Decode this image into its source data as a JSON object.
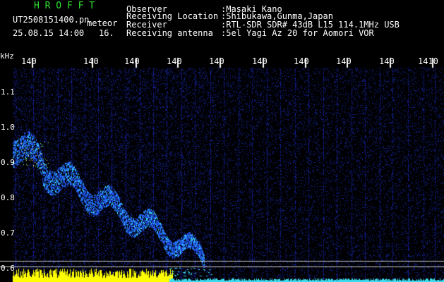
{
  "header": {
    "title": "H R O F F T",
    "filename": "UT2508151400.pn",
    "type_label": "meteor",
    "datetime": "25.08.15 14:00",
    "number": "16.",
    "observer_label": "Observer",
    "observer_value": ":Masaki Kano",
    "location_label": "Receiving Location",
    "location_value": ":Shibukawa,Gunma,Japan",
    "receiver_label": "Receiver",
    "receiver_value": ":RTL-SDR SDR# 43dB L15 114.1MHz USB",
    "antenna_label": "Receiving antenna",
    "antenna_value": ":5el Yagi Az 20 for Aomori VOR"
  },
  "axes": {
    "y_unit": "kHz",
    "y_ticks": [
      "1.1",
      "1.0",
      "0.9",
      "0.8",
      "0.7",
      "0.6"
    ],
    "x_ticks": [
      "140",
      "140",
      "140",
      "140",
      "140",
      "140",
      "140",
      "140",
      "140",
      "1410"
    ]
  },
  "colors": {
    "header_green": "#2fe32f",
    "text_white": "#ffffff",
    "background": "#000000",
    "noise_blue": "#1a2a9a",
    "signal_cyan": "#3fd8ff",
    "signal_yellow": "#ffff00"
  }
}
